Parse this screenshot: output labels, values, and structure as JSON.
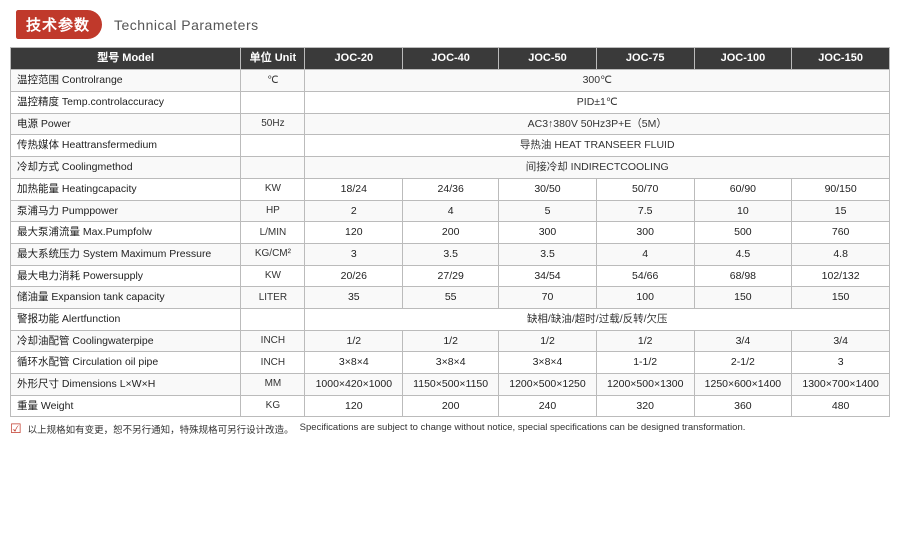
{
  "header": {
    "badge": "技术参数",
    "subtitle": "Technical Parameters"
  },
  "table": {
    "columns": [
      {
        "label": "型号 Model",
        "sub": ""
      },
      {
        "label": "单位 Unit",
        "sub": ""
      },
      {
        "label": "JOC-20",
        "sub": ""
      },
      {
        "label": "JOC-40",
        "sub": ""
      },
      {
        "label": "JOC-50",
        "sub": ""
      },
      {
        "label": "JOC-75",
        "sub": ""
      },
      {
        "label": "JOC-100",
        "sub": ""
      },
      {
        "label": "JOC-150",
        "sub": ""
      }
    ],
    "rows": [
      {
        "label": "温控范围 Controlrange",
        "unit": "℃",
        "merged": true,
        "mergedValue": "300℃",
        "values": []
      },
      {
        "label": "温控精度 Temp.controlaccuracy",
        "unit": "",
        "merged": true,
        "mergedValue": "PID±1℃",
        "values": []
      },
      {
        "label": "电源 Power",
        "unit": "50Hz",
        "merged": true,
        "mergedValue": "AC3↑380V 50Hz3P+E（5M）",
        "values": []
      },
      {
        "label": "传热媒体 Heattransfermedium",
        "unit": "",
        "merged": true,
        "mergedValue": "导热油 HEAT TRANSEER FLUID",
        "values": []
      },
      {
        "label": "冷却方式 Coolingmethod",
        "unit": "",
        "merged": true,
        "mergedValue": "间接冷却 INDIRECTCOOLING",
        "values": []
      },
      {
        "label": "加热能量 Heatingcapacity",
        "unit": "KW",
        "merged": false,
        "values": [
          "18/24",
          "24/36",
          "30/50",
          "50/70",
          "60/90",
          "90/150"
        ]
      },
      {
        "label": "泵浦马力 Pumppower",
        "unit": "HP",
        "merged": false,
        "values": [
          "2",
          "4",
          "5",
          "7.5",
          "10",
          "15"
        ]
      },
      {
        "label": "最大泵浦流量 Max.Pumpfolw",
        "unit": "L/MIN",
        "merged": false,
        "values": [
          "120",
          "200",
          "300",
          "300",
          "500",
          "760"
        ]
      },
      {
        "label": "最大系统压力 System Maximum Pressure",
        "unit": "KG/CM²",
        "merged": false,
        "values": [
          "3",
          "3.5",
          "3.5",
          "4",
          "4.5",
          "4.8"
        ]
      },
      {
        "label": "最大电力消耗 Powersupply",
        "unit": "KW",
        "merged": false,
        "values": [
          "20/26",
          "27/29",
          "34/54",
          "54/66",
          "68/98",
          "102/132"
        ]
      },
      {
        "label": "储油量 Expansion tank capacity",
        "unit": "LITER",
        "merged": false,
        "values": [
          "35",
          "55",
          "70",
          "100",
          "150",
          "150"
        ]
      },
      {
        "label": "警报功能 Alertfunction",
        "unit": "",
        "merged": true,
        "mergedValue": "缺相/缺油/超时/过载/反转/欠压",
        "values": []
      },
      {
        "label": "冷却油配管 Coolingwaterpipe",
        "unit": "INCH",
        "merged": false,
        "values": [
          "1/2",
          "1/2",
          "1/2",
          "1/2",
          "3/4",
          "3/4"
        ]
      },
      {
        "label": "循环水配管 Circulation oil pipe",
        "unit": "INCH",
        "merged": false,
        "values": [
          "3×8×4",
          "3×8×4",
          "3×8×4",
          "1-1/2",
          "2-1/2",
          "3"
        ]
      },
      {
        "label": "外形尺寸 Dimensions L×W×H",
        "unit": "MM",
        "merged": false,
        "values": [
          "1000×420×1000",
          "1150×500×1150",
          "1200×500×1250",
          "1200×500×1300",
          "1250×600×1400",
          "1300×700×1400"
        ]
      },
      {
        "label": "重量 Weight",
        "unit": "KG",
        "merged": false,
        "values": [
          "120",
          "200",
          "240",
          "320",
          "360",
          "480"
        ]
      }
    ]
  },
  "footer": {
    "note_cn": "以上规格如有变更，恕不另行通知，特殊规格可另行设计改造。",
    "note_en": "Specifications are subject to change without notice, special specifications can be designed transformation."
  }
}
